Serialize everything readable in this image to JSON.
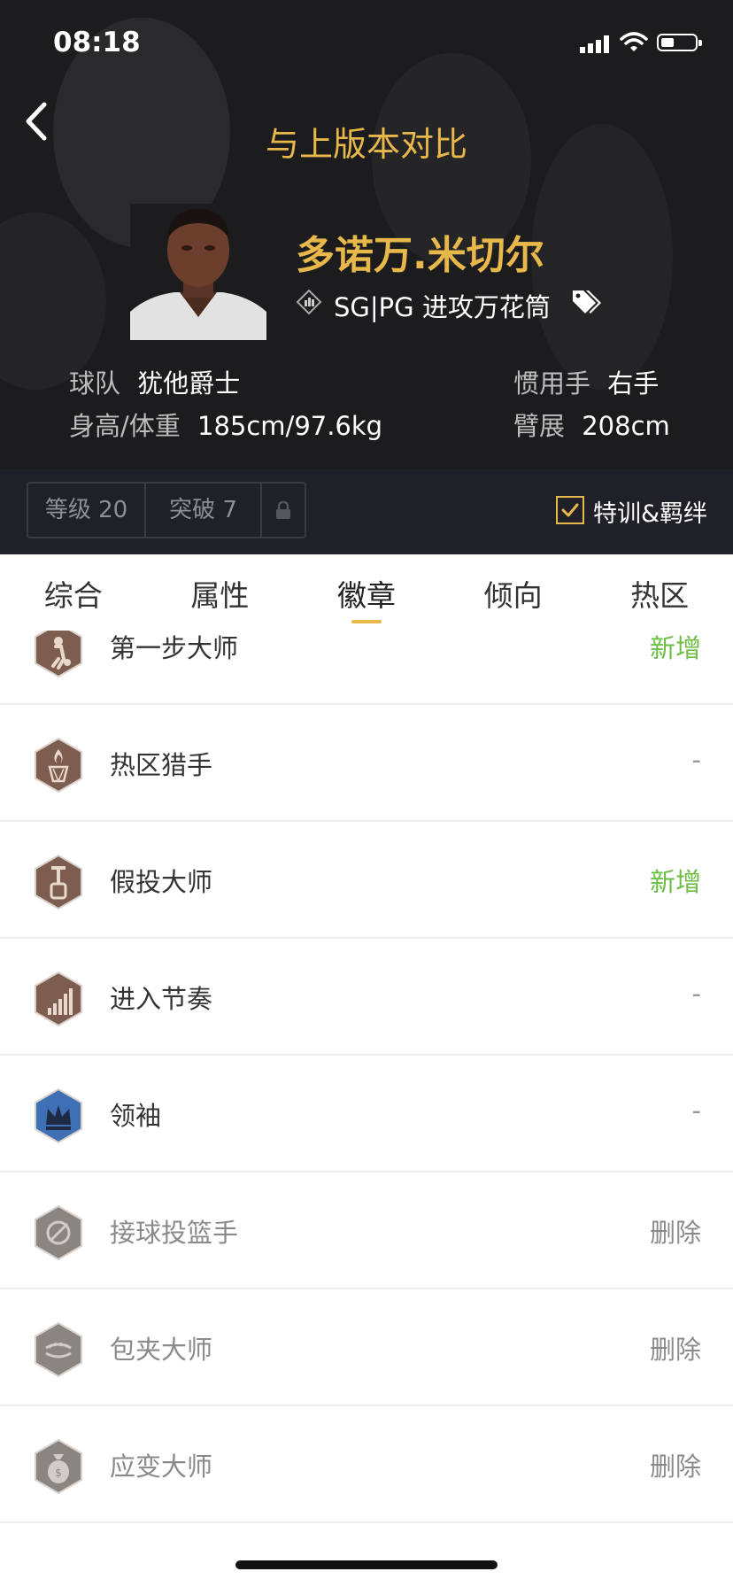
{
  "status_bar": {
    "time": "08:18"
  },
  "header": {
    "title": "与上版本对比",
    "player_name": "多诺万.米切尔",
    "position": "SG|PG 进攻万花筒",
    "team_label": "球队",
    "team_value": "犹他爵士",
    "hand_label": "惯用手",
    "hand_value": "右手",
    "body_label": "身高/体重",
    "body_value": "185cm/97.6kg",
    "wingspan_label": "臂展",
    "wingspan_value": "208cm"
  },
  "stats_bar": {
    "level": "等级 20",
    "breakthrough": "突破 7",
    "training_label": "特训&羁绊",
    "training_checked": true
  },
  "tabs": [
    {
      "label": "综合"
    },
    {
      "label": "属性"
    },
    {
      "label": "徽章",
      "active": true
    },
    {
      "label": "倾向"
    },
    {
      "label": "热区"
    }
  ],
  "badges": [
    {
      "name": "第一步大师",
      "status": "新增",
      "type": "added",
      "icon": "dribble-badge-icon",
      "color": "#7d5d50"
    },
    {
      "name": "热区猎手",
      "status": "-",
      "type": "none",
      "icon": "fire-hoop-badge-icon",
      "color": "#7d5d50"
    },
    {
      "name": "假投大师",
      "status": "新增",
      "type": "added",
      "icon": "pump-badge-icon",
      "color": "#7d5d50"
    },
    {
      "name": "进入节奏",
      "status": "-",
      "type": "none",
      "icon": "bars-badge-icon",
      "color": "#7d5d50"
    },
    {
      "name": "领袖",
      "status": "-",
      "type": "none",
      "icon": "crown-badge-icon",
      "color": "#3f6fb5"
    },
    {
      "name": "接球投篮手",
      "status": "删除",
      "type": "removed",
      "icon": "catch-shoot-badge-icon",
      "color": "#8a8580"
    },
    {
      "name": "包夹大师",
      "status": "删除",
      "type": "removed",
      "icon": "trap-badge-icon",
      "color": "#8a8580"
    },
    {
      "name": "应变大师",
      "status": "删除",
      "type": "removed",
      "icon": "moneybag-badge-icon",
      "color": "#8a8580"
    }
  ],
  "colors": {
    "gold": "#e8b84a",
    "added_green": "#6cbe45",
    "header_bg": "#1c1c1e"
  }
}
